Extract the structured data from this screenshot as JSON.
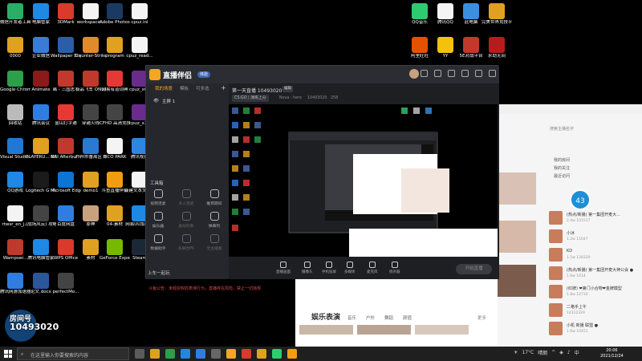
{
  "desktop": {
    "icons_left": [
      {
        "label": "微信开发者工具",
        "color": "#2aae67"
      },
      {
        "label": "电脑管家",
        "color": "#1e88e5"
      },
      {
        "label": "3DMark",
        "color": "#d83b2a"
      },
      {
        "label": "workspace...",
        "color": "#f4f4f4"
      },
      {
        "label": "Adobe Photosho...",
        "color": "#1b3a63"
      },
      {
        "label": "cpuz.ini",
        "color": "#f4f4f4"
      },
      {
        "label": "0000",
        "color": "#e0a020"
      },
      {
        "label": "企业微信",
        "color": "#3a7bd5"
      },
      {
        "label": "Wallpaper Engine...",
        "color": "#2a5ea8"
      },
      {
        "label": "Counter-Strike Global Off...",
        "color": "#e08a2a"
      },
      {
        "label": "program",
        "color": "#e0a020"
      },
      {
        "label": "cpuz_read...",
        "color": "#f4f4f4"
      },
      {
        "label": "Google Chrome",
        "color": "#2b9f4a"
      },
      {
        "label": "Animate",
        "color": "#8b1a1a"
      },
      {
        "label": "离 - 三国志...",
        "color": "#c0392b"
      },
      {
        "label": "极品飞车 ONLINE",
        "color": "#c0392b"
      },
      {
        "label": "网易有道词典",
        "color": "#e53935"
      },
      {
        "label": "cpuz_x64",
        "color": "#6a2c8b"
      },
      {
        "label": "回收站",
        "color": "#bbbbbb"
      },
      {
        "label": "腾讯会议",
        "color": "#2f7de1"
      },
      {
        "label": "金山打字通",
        "color": "#e53935"
      },
      {
        "label": "穿越火线",
        "color": "#444444"
      },
      {
        "label": "CFHD 高清竞技大区",
        "color": "#444444"
      },
      {
        "label": "cpuz_x32",
        "color": "#6a2c8b"
      },
      {
        "label": "Visual Studio Code",
        "color": "#1f78d1"
      },
      {
        "label": "PLAYERU... BATTLEGR...",
        "color": "#e0a020"
      },
      {
        "label": "MSI Afterburner",
        "color": "#c0392b"
      },
      {
        "label": "广州市番禺区 南村镇委员...",
        "color": "#2a7ad3"
      },
      {
        "label": "PICO PARK",
        "color": "#f4f4f4"
      },
      {
        "label": "腾讯视频",
        "color": "#2e86de"
      },
      {
        "label": "QQ游戏",
        "color": "#1e88e5"
      },
      {
        "label": "Logitech G HUB",
        "color": "#1b1b1b"
      },
      {
        "label": "Microsoft Edge",
        "color": "#0c74d4"
      },
      {
        "label": "demo1",
        "color": "#e0a020"
      },
      {
        "label": "斗鱼直播伴侣",
        "color": "#f39c12"
      },
      {
        "label": "新建文本文档.txt",
        "color": "#f4f4f4"
      },
      {
        "label": "rtwsr_en_j...",
        "color": "#f4f4f4"
      },
      {
        "label": "(战场风云) 攻略...",
        "color": "#444444"
      },
      {
        "label": "百度网盘",
        "color": "#2f7de1"
      },
      {
        "label": "原神",
        "color": "#c8a27e"
      },
      {
        "label": "04-素材",
        "color": "#e0a020"
      },
      {
        "label": "网易UU加速器",
        "color": "#1e88e5"
      },
      {
        "label": "Wampser...",
        "color": "#c0392b"
      },
      {
        "label": "腾讯电脑管家",
        "color": "#1e88e5"
      },
      {
        "label": "WPS Office",
        "color": "#d83b2a"
      },
      {
        "label": "素材",
        "color": "#e0a020"
      },
      {
        "label": "GeForce Experience",
        "color": "#76b900"
      },
      {
        "label": "Steam",
        "color": "#1b2838"
      },
      {
        "label": "腾讯网游加速器",
        "color": "#2f7de1"
      },
      {
        "label": "论文.docx",
        "color": "#2b579a"
      },
      {
        "label": "perfectMo...",
        "color": "#444444"
      }
    ],
    "icons_right": [
      {
        "label": "QQ音乐",
        "color": "#2ecc71"
      },
      {
        "label": "腾讯QQ",
        "color": "#f4f4f4"
      },
      {
        "label": "此电脑",
        "color": "#3b8fe0"
      },
      {
        "label": "完美世界竞技平台",
        "color": "#e0a020"
      },
      {
        "label": "阿里旺旺",
        "color": "#e65100"
      },
      {
        "label": "YY",
        "color": "#f4c20d"
      },
      {
        "label": "5E对战平台",
        "color": "#c0392b"
      },
      {
        "label": "永劫无间",
        "color": "#b71c1c"
      }
    ]
  },
  "live_app": {
    "brand": "直播伴侣",
    "badge": "体验",
    "tabs": [
      "我的场景",
      "模板",
      "可多选"
    ],
    "scene_name": "主屏 1",
    "room_title": "第一天直播 10493020",
    "edit_label": "编辑",
    "game_tag": "CS:GO丨演练上分",
    "subtitle": "Nova - hero",
    "room_id": "10493020",
    "viewers": "258",
    "toolbox_label": "工具箱",
    "tools": [
      {
        "label": "视频连麦",
        "dim": false
      },
      {
        "label": "多人连麦",
        "dim": true
      },
      {
        "label": "推荐期间",
        "dim": false
      },
      {
        "label": "娱乐器",
        "dim": false
      },
      {
        "label": "虚拟形象",
        "dim": true
      },
      {
        "label": "弹幕列",
        "dim": false
      },
      {
        "label": "数据助手",
        "dim": false
      },
      {
        "label": "多屏合PK",
        "dim": true
      },
      {
        "label": "无主播素",
        "dim": true
      }
    ],
    "up_label": "上车一起玩",
    "notice": "斗鱼公告：未经授权的表演行为，直播存在风险，禁止一切违规",
    "bottom_items": [
      "直播画面",
      "摄像头",
      "手机投屏",
      "多媒体",
      "麦克风",
      "扬声器"
    ],
    "start_label": "开始直播"
  },
  "browser": {
    "ent_title": "娱乐表演",
    "ent_tabs": [
      "音乐",
      "户外",
      "舞蹈",
      "颜值"
    ],
    "ent_more": "更多",
    "search_hint": "搜索主播名字",
    "side_menu": [
      "我的房间",
      "我的关注",
      "最近访问"
    ],
    "right_list": [
      {
        "title": "(热点/新播) 第一集团开麦大... ",
        "sub": "2.4w 101517"
      },
      {
        "title": "小冰",
        "sub": "1.2w 11047"
      },
      {
        "title": "KD",
        "sub": "1.5w 128320"
      },
      {
        "title": "(热点/新播) 第一集团开麦大神公会 ●",
        "sub": "1.6w 1614"
      },
      {
        "title": "(红牌) ❤第门小合物❤金牌模型",
        "sub": "1.8w 12710"
      },
      {
        "title": "二格手上午",
        "sub": "14312329"
      },
      {
        "title": "小机 新播 联盟 ●",
        "sub": "1.6w 10451"
      }
    ],
    "float_counter": "43"
  },
  "overlay": {
    "line1": "房间号",
    "line2": "10493020"
  },
  "taskbar": {
    "search_placeholder": "在这里输入你要搜索的内容",
    "apps": [
      "#5b5b5b",
      "#e0a020",
      "#2b9f4a",
      "#1e88e5",
      "#2f7de1",
      "#666666",
      "#f5a623",
      "#d83b2a",
      "#e0a020",
      "#2ecc71",
      "#f39c12"
    ],
    "temperature": "17°C",
    "weather": "晴朗",
    "ime": "中",
    "time": "20:06",
    "date": "2021/12/24"
  }
}
